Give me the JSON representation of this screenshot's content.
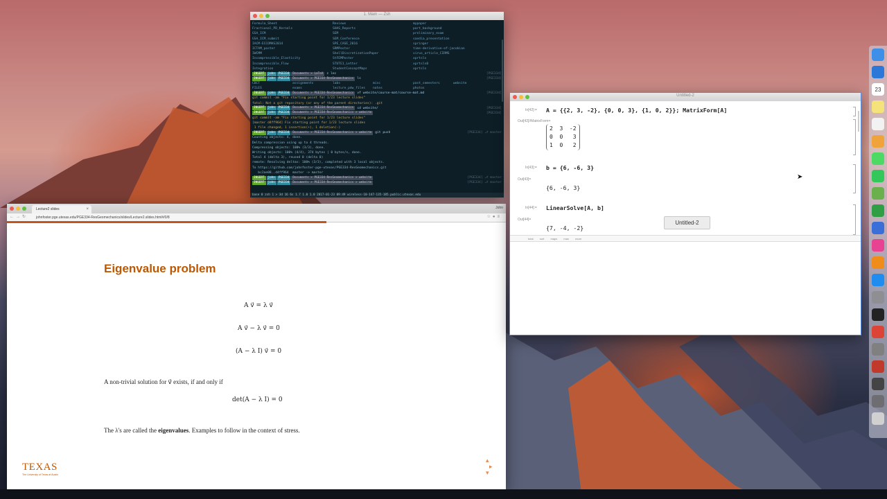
{
  "terminal": {
    "window_title": "1. Main — Zsh",
    "files": [
      [
        "Formula_Sheet",
        "Reviews",
        "mypaper"
      ],
      [
        "Fractional_PD_Kernels",
        "SHAS_Reports",
        "part_background"
      ],
      [
        "GSA_ICM",
        "SEM",
        "preliminary_exam"
      ],
      [
        "GSA_ICM_submit",
        "SEM_Conference",
        "sandia_presentation"
      ],
      [
        "IACM-ECCOMAS2014",
        "SPE_CASE_2016",
        "springer"
      ],
      [
        "ICTAM_poster",
        "SRMPoster",
        "time-derivative-of-jacobian"
      ],
      [
        "IWCMM",
        "ShellDiscretizationPaper",
        "virus_article_CIRMS"
      ],
      [
        "Incompressible_Elasticity",
        "StFEMPoster",
        "xprtsls"
      ],
      [
        "Incompressible_Flow",
        "STUTE1_Letter",
        "xprtsls0"
      ],
      [
        "Integration",
        "StudentConceptMaps",
        "xprtsls"
      ]
    ],
    "prompts": [
      {
        "mode": "INSERT",
        "user": "john",
        "host": "PGE334",
        "path": "Documents > LaTeX",
        "cmd": "z lec",
        "right": "[PGE334]"
      },
      {
        "mode": "INSERT",
        "user": "john",
        "host": "PGE334",
        "path": "Documents > PGE334-ResGeomechanics",
        "cmd": "ls",
        "right": "[PGE334]"
      }
    ],
    "ls_output": [
      [
        "CBCT",
        "assignments",
        "labs",
        "misc",
        "past_semesters",
        "website"
      ],
      [
        "FILES",
        "exams",
        "lecture_pdw_files",
        "notes",
        "photos",
        ""
      ]
    ],
    "prompts2": [
      {
        "mode": "INSERT",
        "user": "john",
        "host": "PGE334",
        "path": "Documents > PGE334-ResGeomechanics",
        "cmd": "vf website/course-mat/course-mat.md",
        "right": "[PGE334]"
      }
    ],
    "git_lines": [
      "git commit -am \"Fix starting point for 1/23 lecture slides\"",
      "fatal: Not a git repository (or any of the parent directories): .git"
    ],
    "prompts3": [
      {
        "mode": "INSERT",
        "user": "john",
        "host": "PGE334",
        "path": "Documents > PGE334-ResGeomechanics",
        "cmd": "cd website/",
        "right": "[PGE334]"
      },
      {
        "mode": "INSERT",
        "user": "john",
        "host": "PGE334",
        "path": "Documents > PGE334-ResGeomechanics > website",
        "cmd": "",
        "right": "[PGE334]"
      }
    ],
    "commit_lines": [
      "git commit -am \"Fix starting point for 1/23 lecture slides\"",
      "[master d4ff964] Fix starting point for 1/23 lecture slides",
      " 1 file changed, 1 insertion(+), 1 deletion(-)"
    ],
    "prompts4": [
      {
        "mode": "INSERT",
        "user": "john",
        "host": "PGE334",
        "path": "Documents > PGE334-ResGeomechanics > website",
        "cmd": "git push",
        "right": "[PGE334] ⎇ master"
      }
    ],
    "push_lines": [
      "Counting objects: 4, done.",
      "Delta compression using up to 4 threads.",
      "Compressing objects: 100% (3/3), done.",
      "Writing objects: 100% (4/4), 374 bytes | 0 bytes/s, done.",
      "Total 4 (delta 3), reused 0 (delta 0)",
      "remote: Resolving deltas: 100% (3/3), completed with 3 local objects.",
      "To https://github.com/johnfoster-pge-utexas/PGE334-ResGeomechanics.git",
      "   bc2ae08..d4ff964  master -> master"
    ],
    "prompts5": [
      {
        "mode": "INSERT",
        "user": "john",
        "host": "PGE334",
        "path": "Documents > PGE334-ResGeomechanics > website",
        "cmd": "",
        "right": "[PGE334] ⎇ master"
      },
      {
        "mode": "INSERT",
        "user": "john",
        "host": "PGE334",
        "path": "Documents > PGE334-ResGeomechanics > website",
        "cmd": "",
        "right": "[PGE334] ⎇ master"
      }
    ],
    "statusbar": "base  0  zsh  1  >  3d 16 6s   1.7 1.0 1.0   2017-01-23   09:49   wireless-10-147-135-185.public.utexas.edu"
  },
  "browser": {
    "tab_title": "Lecture2 slides",
    "profile": "John",
    "url": "johnfoster.pge.utexas.edu/PGE334-ResGeomechanics/slides/Lecture2.slides.html#/0/8",
    "progress_percent": 64,
    "slide": {
      "title": "Eigenvalue problem",
      "eq1": "A v⃗ = λ v⃗",
      "eq2": "A v⃗ − λ v⃗ = 0",
      "eq3": "(A − λ I) v⃗ = 0",
      "text1": "A non-trivial solution for v⃗ exists, if and only if",
      "eq4": "det(A − λ I) = 0",
      "text2_pre": "The λ's are called the ",
      "text2_bold": "eigenvalues",
      "text2_post": ". Examples to follow in the context of stress.",
      "logo": "TEXAS",
      "logo_sub": "The University of Texas at Austin"
    }
  },
  "mathematica": {
    "window_title": "Untitled-2",
    "in42_label": "In[42]:=",
    "in42": "A = {{2, 3, -2}, {0, 0, 3}, {1, 0, 2}}; MatrixForm[A]",
    "out42_label": "Out[42]//MatrixForm=",
    "matrix_rows": [
      "2  3  -2",
      "0  0   3",
      "1  0   2"
    ],
    "in43_label": "In[43]:=",
    "in43": "b = {6, -6, 3}",
    "out43_label": "Out[43]=",
    "out43": "{6, -6, 3}",
    "in44_label": "In[44]:=",
    "in44": "LinearSolve[A, b]",
    "out44_label": "Out[44]=",
    "out44": "{7, -4, -2}",
    "tooltip": "Untitled-2",
    "toolbar": [
      "total",
      "sort",
      "maps",
      "max",
      "more"
    ]
  },
  "dock": {
    "items": [
      "finder-icon",
      "safari-icon",
      "calendar-icon",
      "notes-icon",
      "reminders-icon",
      "photos-icon",
      "messages-icon",
      "facetime-icon",
      "maps-icon",
      "numbers-icon",
      "keynote-icon",
      "itunes-icon",
      "ibooks-icon",
      "app-store-icon",
      "system-preferences-icon",
      "terminal-icon",
      "chrome-icon",
      "texshop-icon",
      "mathematica-icon",
      "activity-icon",
      "utilities-icon",
      "trash-icon"
    ],
    "colors": [
      "#3d8fe8",
      "#2b78d8",
      "#ffffff",
      "#f6e27a",
      "#f2f2f2",
      "#f0a33a",
      "#4cd964",
      "#34c759",
      "#6ab04c",
      "#2f9e44",
      "#3b6fd8",
      "#e84393",
      "#f08c1a",
      "#1f8cf0",
      "#8e8e93",
      "#222222",
      "#db4437",
      "#808080",
      "#c0392b",
      "#444444",
      "#6d6d72",
      "#d0d0d0"
    ],
    "calendar_day": "23"
  }
}
